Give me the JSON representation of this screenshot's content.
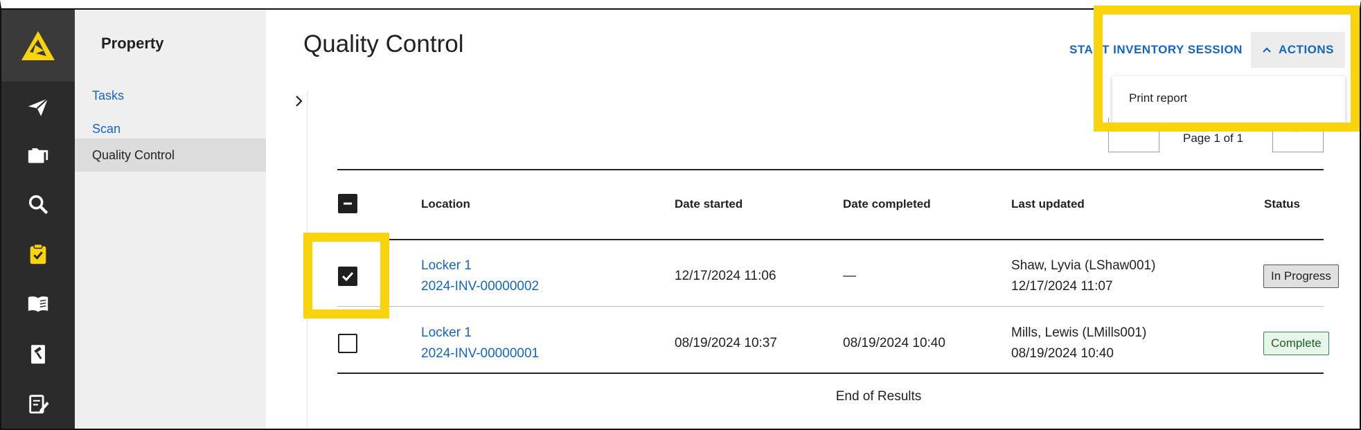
{
  "sidebar": {
    "title": "Property",
    "items": [
      {
        "label": "Tasks"
      },
      {
        "label": "Scan"
      },
      {
        "label": "Quality Control"
      }
    ]
  },
  "rail": {
    "icons": [
      "logo-icon",
      "paper-plane-icon",
      "folders-icon",
      "search-icon",
      "clipboard-check-icon",
      "open-book-icon",
      "gavel-document-icon",
      "edit-note-icon"
    ],
    "accent_color": "#f9d40c"
  },
  "header": {
    "title": "Quality Control",
    "start_session_label": "START INVENTORY SESSION",
    "actions_label": "ACTIONS",
    "actions_menu": [
      {
        "label": "Print report"
      }
    ]
  },
  "pagination": {
    "text": "Page 1 of 1"
  },
  "table": {
    "columns": [
      "Location",
      "Date started",
      "Date completed",
      "Last updated",
      "Status"
    ],
    "rows": [
      {
        "checked": true,
        "location": "Locker 1",
        "session_id": "2024-INV-00000002",
        "date_started": "12/17/2024 11:06",
        "date_completed": "—",
        "updated_by": "Shaw, Lyvia (LShaw001)",
        "updated_at": "12/17/2024 11:07",
        "status": "In Progress"
      },
      {
        "checked": false,
        "location": "Locker 1",
        "session_id": "2024-INV-00000001",
        "date_started": "08/19/2024 10:37",
        "date_completed": "08/19/2024 10:40",
        "updated_by": "Mills, Lewis (LMills001)",
        "updated_at": "08/19/2024 10:40",
        "status": "Complete"
      }
    ],
    "end_text": "End of Results"
  },
  "colors": {
    "link": "#1565c0",
    "highlight": "#f9d40c",
    "rail_bg": "#2b2b2b",
    "complete_border": "#2e8b57"
  }
}
